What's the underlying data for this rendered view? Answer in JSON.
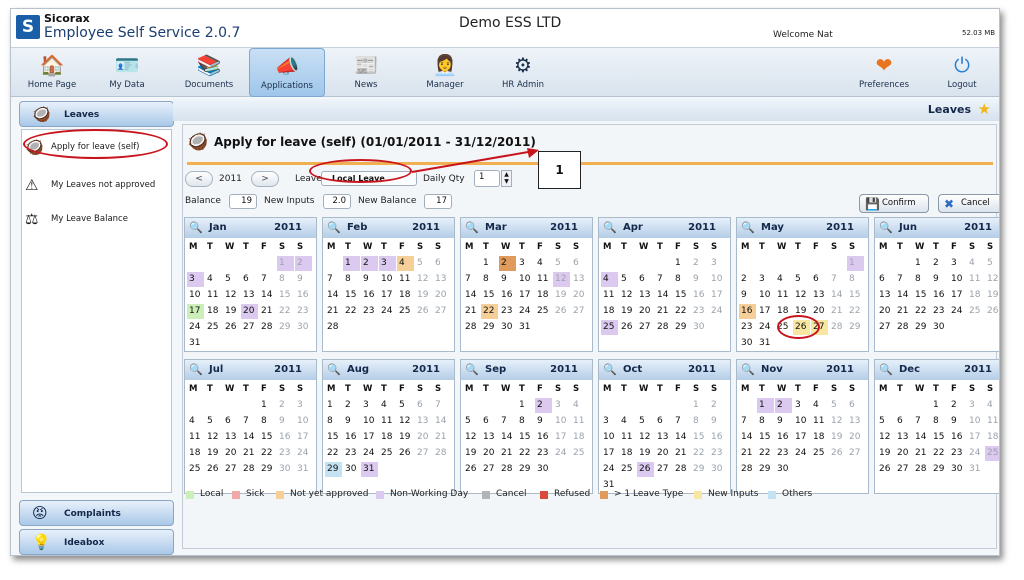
{
  "header": {
    "brand": "Sicorax",
    "product": "Employee Self Service 2.0.7",
    "company": "Demo ESS LTD",
    "welcome": "Welcome Nat",
    "memory": "52.03 MB"
  },
  "toolbar": [
    {
      "label": "Home Page",
      "icon": "house-icon",
      "glyph": "🏠"
    },
    {
      "label": "My Data",
      "icon": "id-card-icon",
      "glyph": "🪪"
    },
    {
      "label": "Documents",
      "icon": "binders-icon",
      "glyph": "📚"
    },
    {
      "label": "Applications",
      "icon": "megaphone-icon",
      "glyph": "📣",
      "active": true
    },
    {
      "label": "News",
      "icon": "newspaper-icon",
      "glyph": "📰"
    },
    {
      "label": "Manager",
      "icon": "manager-icon",
      "glyph": "👩‍💼"
    },
    {
      "label": "HR Admin",
      "icon": "gears-icon",
      "glyph": "⚙"
    },
    {
      "label": "Preferences",
      "icon": "heart-icon",
      "glyph": "❤"
    },
    {
      "label": "Logout",
      "icon": "power-icon",
      "glyph": "⏻"
    }
  ],
  "sidebar": {
    "section_top": {
      "label": "Leaves",
      "icon": "coconut-drink-icon"
    },
    "items": [
      {
        "label": "Apply for leave (self)",
        "icon": "coconut-drink-icon"
      },
      {
        "label": "My Leaves not approved",
        "icon": "warning-drink-icon"
      },
      {
        "label": "My Leave Balance",
        "icon": "scales-icon"
      }
    ],
    "bottom": [
      {
        "label": "Complaints",
        "icon": "angry-face-icon"
      },
      {
        "label": "Ideabox",
        "icon": "light-bulb-icon"
      }
    ]
  },
  "breadcrumb": {
    "title": "Leaves"
  },
  "form": {
    "title": "Apply for leave (self)  (01/01/2011 - 31/12/2011)",
    "prev_label": "<",
    "next_label": ">",
    "year": "2011",
    "leave_label": "Leave",
    "leave_value": "Local Leave",
    "daily_qty_label": "Daily Qty",
    "daily_qty_value": "1",
    "balance_label": "Balance",
    "balance_value": "19",
    "new_inputs_label": "New Inputs",
    "new_inputs_value": "2.0",
    "new_balance_label": "New Balance",
    "new_balance_value": "17",
    "confirm_label": "Confirm",
    "cancel_label": "Cancel"
  },
  "annotation": {
    "label": "1"
  },
  "calendar": {
    "day_headers": [
      "M",
      "T",
      "W",
      "T",
      "F",
      "S",
      "S"
    ],
    "months": [
      {
        "name": "Jan",
        "year": "2011",
        "offset": 5,
        "days": 31,
        "marks": {
          "1": "nw",
          "2": "nw",
          "3": "nw",
          "17": "local",
          "20": "nw"
        }
      },
      {
        "name": "Feb",
        "year": "2011",
        "offset": 1,
        "days": 28,
        "marks": {
          "1": "nw",
          "2": "nw",
          "3": "nw",
          "4": "nya"
        }
      },
      {
        "name": "Mar",
        "year": "2011",
        "offset": 1,
        "days": 31,
        "marks": {
          "2": "multi",
          "12": "nw",
          "22": "nya"
        }
      },
      {
        "name": "Apr",
        "year": "2011",
        "offset": 4,
        "days": 30,
        "marks": {
          "4": "nw",
          "25": "nw"
        }
      },
      {
        "name": "May",
        "year": "2011",
        "offset": 6,
        "days": 31,
        "marks": {
          "1": "nw",
          "16": "nya",
          "26": "inp",
          "27": "inp"
        }
      },
      {
        "name": "Jun",
        "year": "2011",
        "offset": 2,
        "days": 30,
        "marks": {}
      },
      {
        "name": "Jul",
        "year": "2011",
        "offset": 4,
        "days": 31,
        "marks": {}
      },
      {
        "name": "Aug",
        "year": "2011",
        "offset": 0,
        "days": 31,
        "marks": {
          "29": "oth",
          "31": "nw"
        }
      },
      {
        "name": "Sep",
        "year": "2011",
        "offset": 3,
        "days": 30,
        "marks": {
          "2": "nw"
        }
      },
      {
        "name": "Oct",
        "year": "2011",
        "offset": 5,
        "days": 31,
        "marks": {
          "26": "nw"
        }
      },
      {
        "name": "Nov",
        "year": "2011",
        "offset": 1,
        "days": 30,
        "marks": {
          "1": "nw",
          "2": "nw"
        }
      },
      {
        "name": "Dec",
        "year": "2011",
        "offset": 3,
        "days": 31,
        "marks": {
          "25": "nw"
        }
      }
    ]
  },
  "legend": [
    {
      "label": "Local",
      "color": "#ccefb9"
    },
    {
      "label": "Sick",
      "color": "#f0a8a8"
    },
    {
      "label": "Not yet approved",
      "color": "#f6cf98"
    },
    {
      "label": "Non-Working Day",
      "color": "#dcc9f0"
    },
    {
      "label": "Cancel",
      "color": "#b4b4b4"
    },
    {
      "label": "Refused",
      "color": "#d84a3c"
    },
    {
      "label": "> 1 Leave Type",
      "color": "#df9a5c"
    },
    {
      "label": "New Inputs",
      "color": "#f8e7a2"
    },
    {
      "label": "Others",
      "color": "#c3e3f2"
    }
  ],
  "colors": {
    "accent": "#1a5ea8",
    "annotation": "#c8151d",
    "progress_line": "#f0b050"
  }
}
